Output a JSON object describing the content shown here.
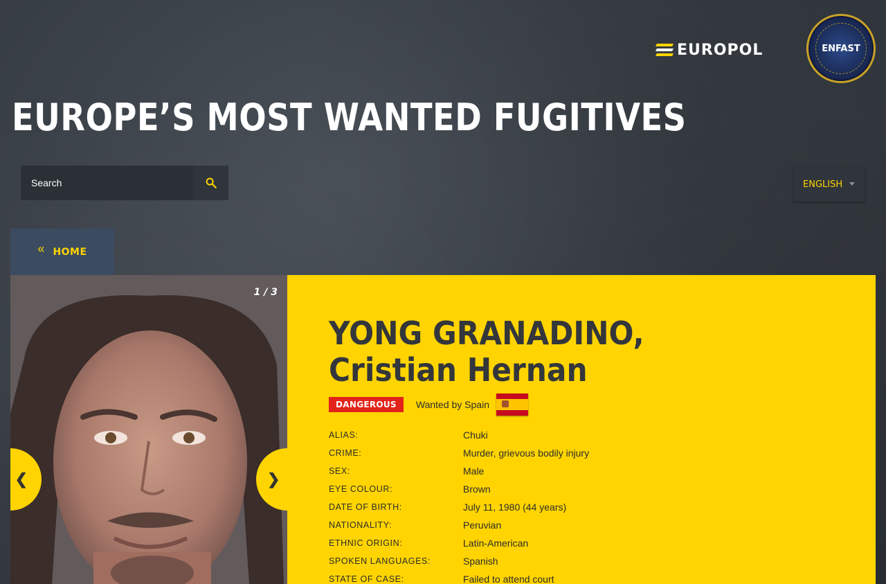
{
  "header": {
    "europol_logo_text": "EUROPOL",
    "enfast_logo_text": "ENFAST",
    "page_title": "EUROPE’S MOST WANTED FUGITIVES"
  },
  "search": {
    "placeholder": "Search",
    "icon": "search-icon"
  },
  "language": {
    "selected": "ENGLISH"
  },
  "nav": {
    "home_label": "HOME",
    "home_icon": "double-chevron-left-icon"
  },
  "gallery": {
    "counter": "1 / 3",
    "prev_symbol": "❮",
    "next_symbol": "❯"
  },
  "fugitive": {
    "name": "YONG GRANADINO, Cristian Hernan",
    "badge": "DANGEROUS",
    "wanted_by": "Wanted by Spain",
    "flag": "spain-flag",
    "details": [
      {
        "label": "ALIAS:",
        "value": "Chuki"
      },
      {
        "label": "CRIME:",
        "value": "Murder, grievous bodily injury"
      },
      {
        "label": "SEX:",
        "value": "Male"
      },
      {
        "label": "EYE COLOUR:",
        "value": "Brown"
      },
      {
        "label": "DATE OF BIRTH:",
        "value": "July 11, 1980 (44 years)"
      },
      {
        "label": "NATIONALITY:",
        "value": "Peruvian"
      },
      {
        "label": "ETHNIC ORIGIN:",
        "value": "Latin-American"
      },
      {
        "label": "SPOKEN LANGUAGES:",
        "value": "Spanish"
      },
      {
        "label": "STATE OF CASE:",
        "value": "Failed to attend court"
      }
    ]
  },
  "colors": {
    "accent_yellow": "#ffd400",
    "danger_red": "#e2231a",
    "panel_dark": "#30353b"
  }
}
